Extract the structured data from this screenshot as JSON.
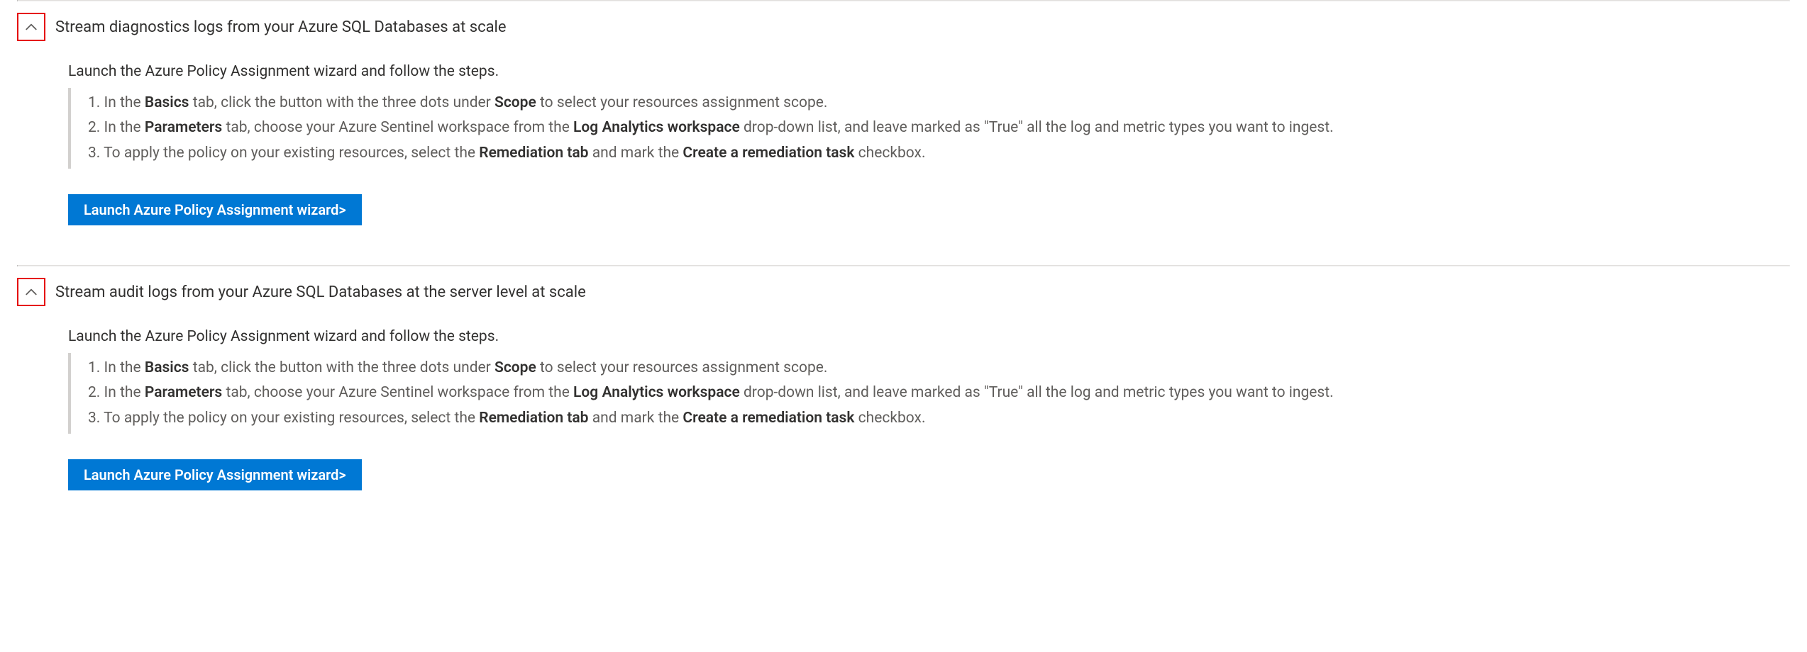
{
  "sections": [
    {
      "id": "diagnostics",
      "title": "Stream diagnostics logs from your Azure SQL Databases at scale",
      "lead": "Launch the Azure Policy Assignment wizard and follow the steps.",
      "steps": [
        {
          "prefix": "1. In the ",
          "b1": "Basics",
          "mid1": " tab, click the button with the three dots under ",
          "b2": "Scope",
          "suffix": " to select your resources assignment scope."
        },
        {
          "prefix": "2. In the ",
          "b1": "Parameters",
          "mid1": " tab, choose your Azure Sentinel workspace from the ",
          "b2": "Log Analytics workspace",
          "suffix": " drop-down list, and leave marked as \"True\" all the log and metric types you want to ingest."
        },
        {
          "prefix": "3. To apply the policy on your existing resources, select the ",
          "b1": "Remediation tab",
          "mid1": " and mark the ",
          "b2": "Create a remediation task",
          "suffix": " checkbox."
        }
      ],
      "button": "Launch Azure Policy Assignment wizard>"
    },
    {
      "id": "audit",
      "title": "Stream audit logs from your Azure SQL Databases at the server level at scale",
      "lead": "Launch the Azure Policy Assignment wizard and follow the steps.",
      "steps": [
        {
          "prefix": "1. In the ",
          "b1": "Basics",
          "mid1": " tab, click the button with the three dots under ",
          "b2": "Scope",
          "suffix": " to select your resources assignment scope."
        },
        {
          "prefix": "2. In the ",
          "b1": "Parameters",
          "mid1": " tab, choose your Azure Sentinel workspace from the ",
          "b2": "Log Analytics workspace",
          "suffix": " drop-down list, and leave marked as \"True\" all the log and metric types you want to ingest."
        },
        {
          "prefix": "3. To apply the policy on your existing resources, select the ",
          "b1": "Remediation tab",
          "mid1": " and mark the ",
          "b2": "Create a remediation task",
          "suffix": " checkbox."
        }
      ],
      "button": "Launch Azure Policy Assignment wizard>"
    }
  ]
}
